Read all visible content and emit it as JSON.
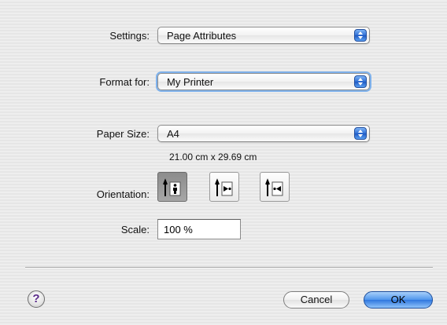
{
  "settings": {
    "label": "Settings:",
    "value": "Page Attributes"
  },
  "format_for": {
    "label": "Format for:",
    "value": "My Printer"
  },
  "paper_size": {
    "label": "Paper Size:",
    "value": "A4",
    "dimensions": "21.00 cm x 29.69 cm"
  },
  "orientation": {
    "label": "Orientation:",
    "options": [
      "portrait",
      "landscape-left",
      "landscape-right"
    ],
    "selected": "portrait"
  },
  "scale": {
    "label": "Scale:",
    "value": "100 %"
  },
  "buttons": {
    "help": "?",
    "cancel": "Cancel",
    "ok": "OK"
  },
  "colors": {
    "accent": "#2f77de",
    "selected_orientation": "#9a9a9a"
  },
  "icons": [
    "popup-arrows-icon",
    "portrait-icon",
    "landscape-left-icon",
    "landscape-right-icon",
    "help-icon"
  ]
}
